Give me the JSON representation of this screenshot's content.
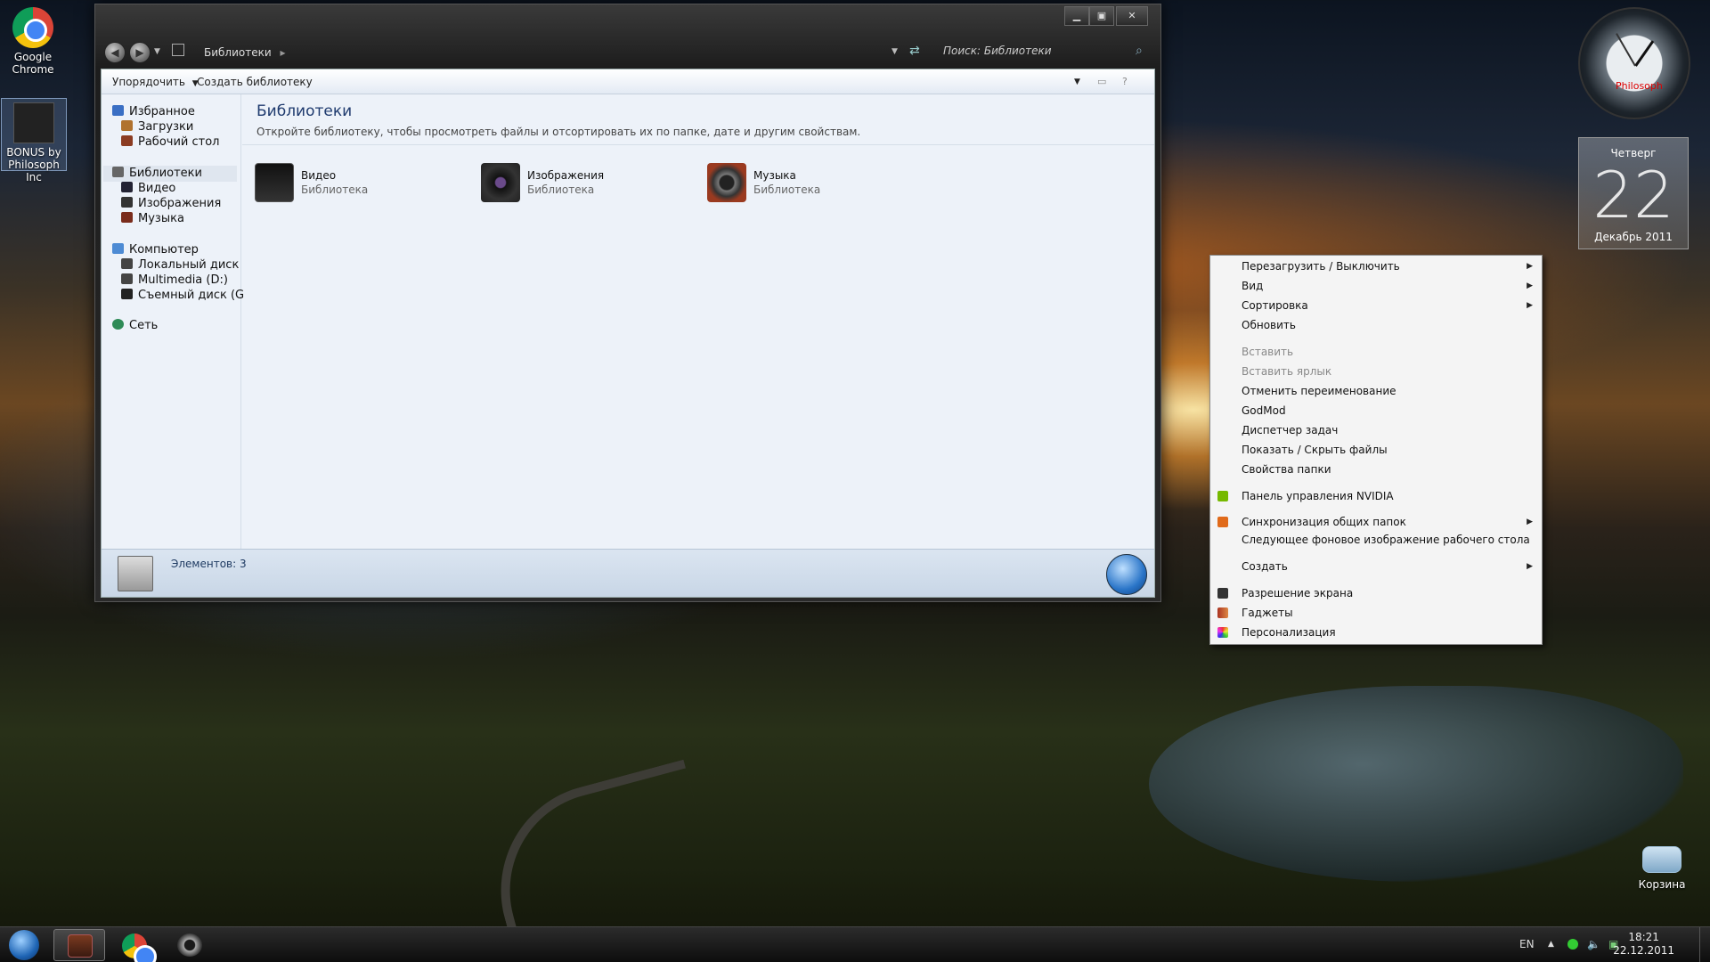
{
  "desktop": {
    "icons": [
      {
        "label": "Google Chrome",
        "icon": "chrome-icon"
      },
      {
        "label": "BONUS by Philosoph Inc",
        "icon": "folder-icon"
      },
      {
        "label": "Корзина",
        "icon": "recycle-bin-icon"
      }
    ]
  },
  "window": {
    "breadcrumb": "Библиотеки",
    "search_placeholder": "Поиск: Библиотеки",
    "toolbar": {
      "organize": "Упорядочить",
      "create_library": "Создать библиотеку"
    },
    "sidebar": {
      "favorites": {
        "label": "Избранное",
        "items": [
          "Загрузки",
          "Рабочий стол"
        ]
      },
      "libraries": {
        "label": "Библиотеки",
        "items": [
          "Видео",
          "Изображения",
          "Музыка"
        ]
      },
      "computer": {
        "label": "Компьютер",
        "items": [
          "Локальный диск",
          "Multimedia (D:)",
          "Съемный диск (G"
        ]
      },
      "network": {
        "label": "Сеть"
      }
    },
    "content": {
      "title": "Библиотеки",
      "subtitle": "Откройте библиотеку, чтобы просмотреть файлы и отсортировать их по папке, дате и другим свойствам.",
      "libraries": [
        {
          "name": "Видео",
          "type": "Библиотека",
          "icon": "video-library-icon"
        },
        {
          "name": "Изображения",
          "type": "Библиотека",
          "icon": "camera-library-icon"
        },
        {
          "name": "Музыка",
          "type": "Библиотека",
          "icon": "speaker-library-icon"
        }
      ]
    },
    "status": {
      "items_count": "Элементов: 3"
    }
  },
  "gadgets": {
    "clock_label": "Philosoph",
    "calendar": {
      "weekday": "Четверг",
      "day": "22",
      "month_year": "Декабрь 2011"
    }
  },
  "context_menu": {
    "items": [
      {
        "label": "Перезагрузить / Выключить",
        "submenu": true
      },
      {
        "label": "Вид",
        "submenu": true
      },
      {
        "label": "Сортировка",
        "submenu": true
      },
      {
        "label": "Обновить"
      },
      {
        "label": "Вставить",
        "disabled": true
      },
      {
        "label": "Вставить ярлык",
        "disabled": true
      },
      {
        "label": "Отменить переименование"
      },
      {
        "label": "GodMod"
      },
      {
        "label": "Диспетчер задач"
      },
      {
        "label": "Показать / Скрыть файлы"
      },
      {
        "label": "Свойства папки"
      },
      {
        "label": "Панель управления NVIDIA",
        "icon": "nvidia-icon"
      },
      {
        "label": "Синхронизация общих папок",
        "submenu": true,
        "icon": "sync-icon"
      },
      {
        "label": "Следующее фоновое изображение рабочего стола"
      },
      {
        "label": "Создать",
        "submenu": true
      },
      {
        "label": "Разрешение экрана",
        "icon": "display-icon"
      },
      {
        "label": "Гаджеты",
        "icon": "gadgets-icon"
      },
      {
        "label": "Персонализация",
        "icon": "personalize-icon"
      }
    ]
  },
  "taskbar": {
    "language": "EN",
    "time": "18:21",
    "date": "22.12.2011"
  }
}
